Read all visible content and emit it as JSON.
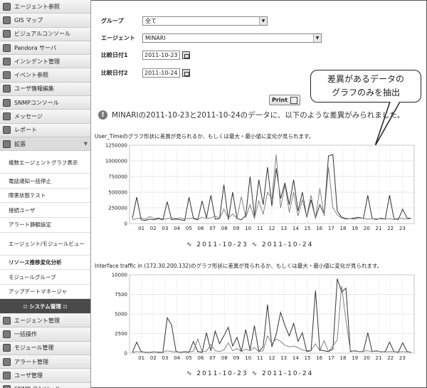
{
  "sidebar": {
    "items_top": [
      {
        "label": "エージェント参照"
      },
      {
        "label": "GIS マップ"
      },
      {
        "label": "ビジュアルコンソール"
      },
      {
        "label": "Pandora サーバ"
      },
      {
        "label": "インシデント管理"
      },
      {
        "label": "イベント参照"
      },
      {
        "label": "ユーザ情報編集"
      },
      {
        "label": "SNMPコンソール"
      },
      {
        "label": "メッセージ"
      },
      {
        "label": "レポート"
      },
      {
        "label": "拡張"
      }
    ],
    "sub_items": [
      {
        "label": "複数エージェントグラフ表示"
      },
      {
        "label": "電話通知一括停止"
      },
      {
        "label": "障害状態テスト"
      },
      {
        "label": "接続ユーザ"
      },
      {
        "label": "アラート静観設定"
      },
      {
        "label": "エージェント/モジュールビュー"
      },
      {
        "label": "リソース推移変化分析"
      },
      {
        "label": "モジュールグループ"
      },
      {
        "label": "アップデートマネージャ"
      },
      {
        "label": ":: システム管理 ::"
      }
    ],
    "items_bottom": [
      {
        "label": "エージェント管理"
      },
      {
        "label": "一括操作"
      },
      {
        "label": "モジュール管理"
      },
      {
        "label": "アラート管理"
      },
      {
        "label": "ユーザ管理"
      },
      {
        "label": "SNMP コンソール"
      }
    ]
  },
  "form": {
    "group_label": "グループ",
    "group_value": "全て",
    "agent_label": "エージェント",
    "agent_value": "MINARI",
    "date1_label": "比較日付1",
    "date1_value": "2011-10-23",
    "date2_label": "比較日付2",
    "date2_value": "2011-10-24"
  },
  "callout": {
    "line1": "差異があるデータの",
    "line2": "グラフのみを抽出"
  },
  "print_label": "Print",
  "message": "MINARIの2011-10-23と2011-10-24のデータに、以下のような差異がみられました。",
  "charts": [
    {
      "caption": "User_Timeのグラフ形状に差異が見られるか、もしくは最大・最小値に変化が見られます。",
      "legend_a": "2011-10-23",
      "legend_b": "2011-10-24"
    },
    {
      "caption": "Interface traffic in (172.30.200.132)のグラフ形状に差異が見られるか、もしくは最大・最小値に変化が見られます。",
      "legend_a": "2011-10-23",
      "legend_b": "2011-10-24"
    }
  ],
  "chart_data": [
    {
      "type": "line",
      "y_ticks": [
        "1250000",
        "1000000",
        "750000",
        "500000",
        "250000",
        "0"
      ],
      "ylim": [
        0,
        1250000
      ],
      "x_ticks": [
        "01",
        "02",
        "03",
        "04",
        "05",
        "06",
        "07",
        "08",
        "09",
        "10",
        "11",
        "12",
        "13",
        "14",
        "15",
        "16",
        "17",
        "18",
        "19",
        "20",
        "21",
        "22",
        "23"
      ],
      "series": [
        {
          "name": "2011-10-23",
          "values": [
            80000,
            420000,
            60000,
            50000,
            70000,
            60000,
            80000,
            60000,
            350000,
            60000,
            70000,
            60000,
            50000,
            420000,
            80000,
            60000,
            360000,
            90000,
            450000,
            70000,
            80000,
            620000,
            60000,
            500000,
            80000,
            60000,
            130000,
            750000,
            120000,
            700000,
            300000,
            900000,
            280000,
            880000,
            400000,
            650000,
            300000,
            700000,
            200000,
            500000,
            100000,
            380000,
            90000,
            300000,
            150000,
            1080000,
            1100000,
            200000,
            100000,
            80000,
            80000,
            90000,
            100000,
            80000,
            450000,
            80000,
            70000,
            80000,
            70000,
            450000,
            80000,
            60000,
            230000,
            90000,
            80000
          ]
        },
        {
          "name": "2011-10-24",
          "values": [
            60000,
            80000,
            90000,
            70000,
            110000,
            80000,
            90000,
            70000,
            80000,
            90000,
            80000,
            90000,
            70000,
            80000,
            90000,
            70000,
            100000,
            80000,
            90000,
            120000,
            80000,
            230000,
            90000,
            150000,
            80000,
            430000,
            100000,
            300000,
            80000,
            360000,
            150000,
            500000,
            400000,
            1100000,
            250000,
            620000,
            180000,
            500000,
            120000,
            380000,
            110000,
            450000,
            90000,
            560000,
            120000,
            900000,
            250000,
            140000,
            90000,
            70000,
            80000,
            70000,
            90000,
            80000,
            70000,
            80000,
            60000,
            90000,
            70000,
            80000,
            60000,
            90000,
            80000,
            70000,
            80000
          ]
        }
      ]
    },
    {
      "type": "line",
      "y_ticks": [
        "10000",
        "7500",
        "5000",
        "2500",
        "0"
      ],
      "ylim": [
        0,
        10000
      ],
      "x_ticks": [
        "01",
        "02",
        "03",
        "04",
        "05",
        "06",
        "07",
        "08",
        "09",
        "10",
        "11",
        "12",
        "13",
        "14",
        "15",
        "16",
        "17",
        "18",
        "19",
        "20",
        "21",
        "22",
        "23"
      ],
      "series": [
        {
          "name": "2011-10-23",
          "values": [
            100,
            1400,
            200,
            100,
            100,
            150,
            100,
            100,
            4500,
            3600,
            200,
            100,
            150,
            100,
            1500,
            200,
            100,
            2600,
            300,
            2800,
            1200,
            2200,
            3300,
            900,
            2000,
            200,
            3000,
            400,
            3500,
            200,
            800,
            6200,
            800,
            2400,
            5200,
            3500,
            2200,
            3800,
            1500,
            2600,
            200,
            300,
            8000,
            400,
            300,
            200,
            500,
            9500,
            7800,
            8300,
            200,
            300,
            200,
            200,
            2600,
            200,
            300,
            150,
            200,
            1400,
            200,
            100,
            1300,
            200,
            100
          ]
        },
        {
          "name": "2011-10-24",
          "values": [
            80,
            200,
            150,
            120,
            100,
            130,
            150,
            120,
            300,
            200,
            150,
            120,
            200,
            150,
            250,
            1800,
            200,
            250,
            1100,
            300,
            200,
            400,
            1300,
            300,
            600,
            200,
            500,
            300,
            700,
            200,
            300,
            2200,
            1200,
            1800,
            1500,
            1000,
            800,
            900,
            700,
            400,
            300,
            350,
            1200,
            300,
            1600,
            200,
            900,
            1700,
            8600,
            4200,
            300,
            250,
            200,
            250,
            300,
            200,
            250,
            200,
            150,
            200,
            180,
            150,
            200,
            150,
            120
          ]
        }
      ]
    }
  ]
}
